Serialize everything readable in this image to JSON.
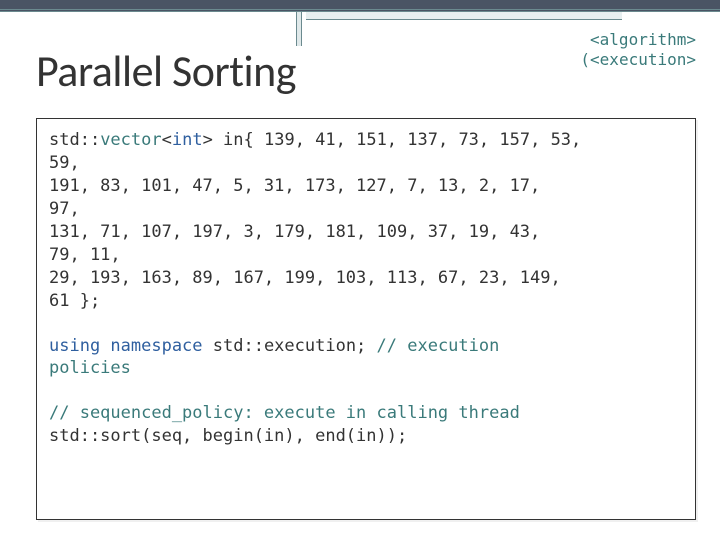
{
  "headers": {
    "algo": "<algorithm>",
    "exec": "(<execution>"
  },
  "title": "Parallel Sorting",
  "code": {
    "l1a": "std::",
    "l1b": "vector",
    "l1c": "<",
    "l1d": "int",
    "l1e": "> in{ 139, 41, 151, 137, 73, 157, 53,",
    "l2": "59,",
    "l3": "  191, 83, 101, 47, 5, 31, 173, 127, 7, 13, 2, 17,",
    "l4": "97,",
    "l5": "  131, 71, 107, 197, 3, 179, 181, 109, 37, 19, 43,",
    "l6": "79, 11,",
    "l7": "  29, 193, 163, 89, 167, 199, 103, 113, 67, 23, 149,",
    "l8": "61 };",
    "u1a": "using namespace ",
    "u1b": "std::execution;  ",
    "u1c": "// execution",
    "u2": "policies",
    "c1": "// sequenced_policy: execute in calling thread",
    "s1": "std::sort(seq, begin(in), end(in));"
  }
}
